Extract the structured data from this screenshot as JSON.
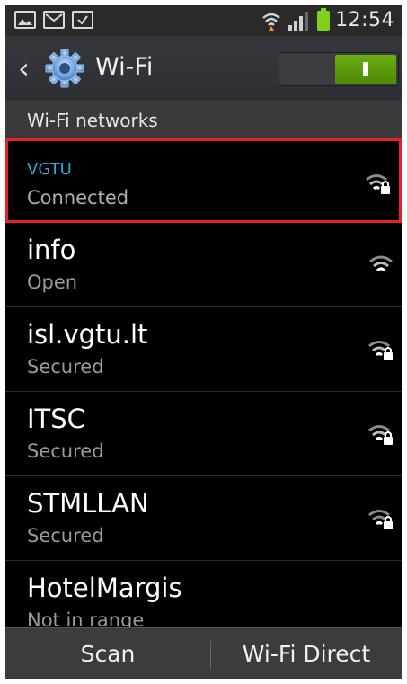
{
  "status_bar": {
    "left_icons": [
      "gallery-icon",
      "message-icon",
      "clipboard-icon"
    ],
    "right_icons": [
      "wifi-icon",
      "signal-icon",
      "battery-icon"
    ],
    "time": "12:54"
  },
  "action_bar": {
    "title": "Wi-Fi",
    "toggle_state": "on",
    "accent_color": "#5fa010"
  },
  "section": {
    "label": "Wi-Fi networks"
  },
  "networks": [
    {
      "name": "VGTU",
      "status": "Connected",
      "secured": true,
      "highlighted": true
    },
    {
      "name": "info",
      "status": "Open",
      "secured": false
    },
    {
      "name": "isl.vgtu.lt",
      "status": "Secured",
      "secured": true
    },
    {
      "name": "ITSC",
      "status": "Secured",
      "secured": true
    },
    {
      "name": "STMLLAN",
      "status": "Secured",
      "secured": true
    },
    {
      "name": "HotelMargis",
      "status": "Not in range",
      "secured": false
    }
  ],
  "bottom_bar": {
    "scan_label": "Scan",
    "direct_label": "Wi-Fi Direct"
  },
  "colors": {
    "highlight_border": "#e8202a",
    "connected_name": "#2fa8e0"
  }
}
